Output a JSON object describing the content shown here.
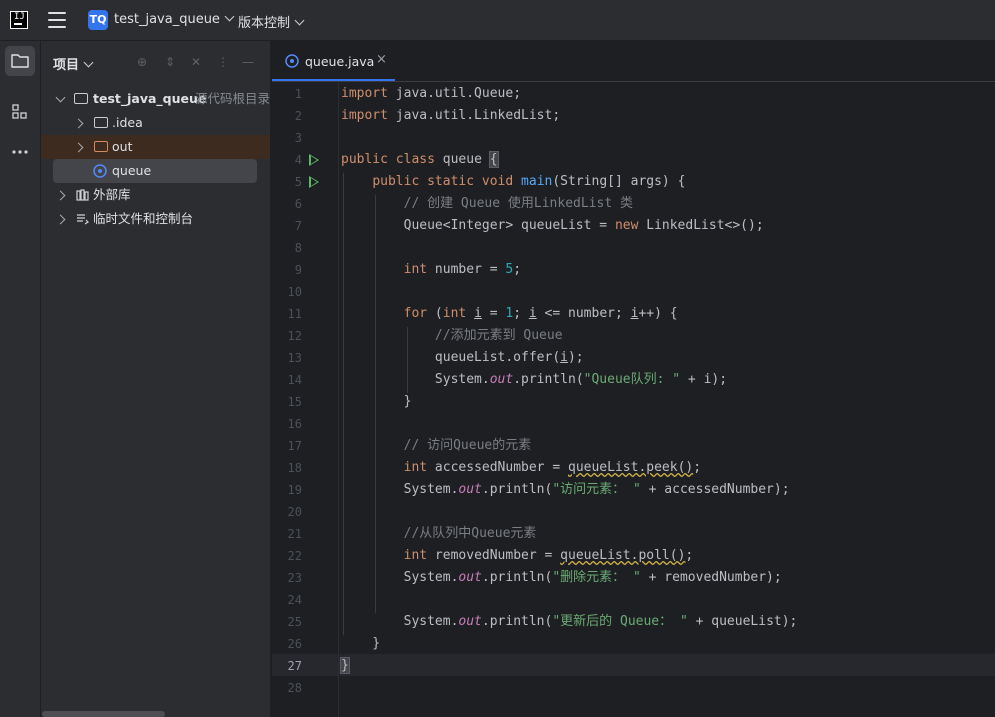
{
  "titlebar": {
    "project_badge": "TQ",
    "project_name": "test_java_queue",
    "vcs_label": "版本控制"
  },
  "project_panel": {
    "title": "项目",
    "tree": [
      {
        "label": "test_java_queue",
        "hint": "源代码根目录",
        "depth": 0,
        "expanded": true,
        "kind": "module"
      },
      {
        "label": ".idea",
        "depth": 1,
        "expanded": false,
        "kind": "folder"
      },
      {
        "label": "out",
        "depth": 1,
        "expanded": false,
        "kind": "folder-excluded"
      },
      {
        "label": "queue",
        "depth": 1,
        "kind": "java-class",
        "selected": true
      },
      {
        "label": "外部库",
        "depth": 0,
        "expanded": false,
        "kind": "libraries"
      },
      {
        "label": "临时文件和控制台",
        "depth": 0,
        "expanded": false,
        "kind": "scratches"
      }
    ]
  },
  "editor": {
    "tab": {
      "label": "queue.java",
      "icon": "java-class-icon"
    },
    "current_line": 27,
    "run_markers": [
      4,
      5
    ],
    "lines": [
      "import java.util.Queue;",
      "import java.util.LinkedList;",
      "",
      "public class queue {",
      "    public static void main(String[] args) {",
      "        // 创建 Queue 使用LinkedList 类",
      "        Queue<Integer> queueList = new LinkedList<>();",
      "",
      "        int number = 5;",
      "",
      "        for (int i = 1; i <= number; i++) {",
      "            //添加元素到 Queue",
      "            queueList.offer(i);",
      "            System.out.println(\"Queue队列: \" + i);",
      "        }",
      "",
      "        // 访问Queue的元素",
      "        int accessedNumber = queueList.peek();",
      "        System.out.println(\"访问元素： \" + accessedNumber);",
      "",
      "        //从队列中Queue元素",
      "        int removedNumber = queueList.poll();",
      "        System.out.println(\"删除元素： \" + removedNumber);",
      "",
      "        System.out.println(\"更新后的 Queue： \" + queueList);",
      "    }",
      "}",
      ""
    ]
  },
  "colors": {
    "accent": "#3574f0",
    "keyword": "#cf8e6d",
    "string": "#6aab73",
    "comment": "#7a7e85",
    "number": "#2aacb8",
    "method": "#56a8f5",
    "static_field": "#c77dbb",
    "run_marker": "#5fb865"
  }
}
